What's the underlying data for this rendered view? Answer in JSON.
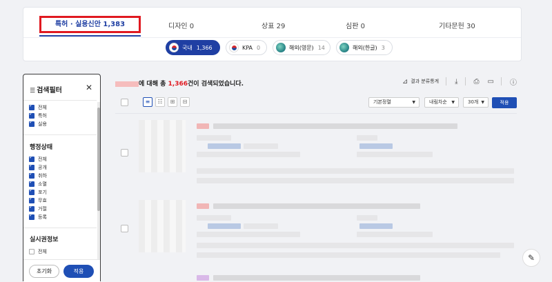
{
  "tabs": [
    {
      "label": "특허 · 실용신안 1,383"
    },
    {
      "label": "디자인 0"
    },
    {
      "label": "상표 29"
    },
    {
      "label": "심판 0"
    },
    {
      "label": "기타문헌 30"
    }
  ],
  "chips": [
    {
      "label": "국내",
      "count": "1,366"
    },
    {
      "label": "KPA",
      "count": "0"
    },
    {
      "label": "해외(영문)",
      "count": "14"
    },
    {
      "label": "해외(한글)",
      "count": "3"
    }
  ],
  "filter": {
    "title": "검색필터",
    "close": "✕",
    "type_options": [
      "전체",
      "특허",
      "실용"
    ],
    "status_title": "행정상태",
    "status_options": [
      "전체",
      "공개",
      "취하",
      "소멸",
      "포기",
      "무효",
      "거절",
      "등록"
    ],
    "rights_title": "실시권정보",
    "rights_options": [
      "전체"
    ],
    "reset_label": "초기화",
    "apply_label": "적용"
  },
  "results": {
    "head_pre": "에 대해 총 ",
    "head_count": "1,366",
    "head_post": "건이 검색되었습니다.",
    "stats_label": "결과 분류통계",
    "sort_label": "기본정렬",
    "order_label": "내림차순",
    "perpage_label": "30개",
    "apply_label": "적용"
  }
}
